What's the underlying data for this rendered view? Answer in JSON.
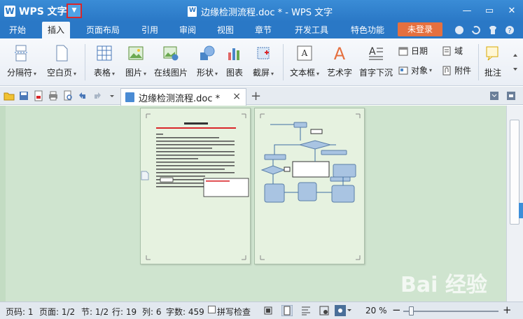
{
  "app": {
    "name": "WPS 文字",
    "menu_caret": "▼"
  },
  "window": {
    "title": "边缘检测流程.doc * - WPS 文字",
    "min": "—",
    "restore": "▭",
    "close": "✕"
  },
  "menu_tabs": [
    "开始",
    "插入",
    "页面布局",
    "引用",
    "审阅",
    "视图",
    "章节",
    "开发工具",
    "特色功能"
  ],
  "login": "未登录",
  "ribbon": {
    "separator": "分隔符",
    "blank_page": "空白页",
    "table": "表格",
    "picture": "图片",
    "online_picture": "在线图片",
    "shape": "形状",
    "chart": "图表",
    "screenshot": "截屏",
    "textbox": "文本框",
    "wordart": "艺术字",
    "dropcap": "首字下沉",
    "date": "日期",
    "field": "域",
    "object": "对象",
    "attachment": "附件",
    "annotate": "批注"
  },
  "doc_tab": {
    "label": "边缘检测流程.doc *",
    "close": "×",
    "add": "+"
  },
  "status": {
    "page_no": "页码: 1",
    "pages": "页面: 1/2",
    "section": "节: 1/2",
    "row": "行: 19",
    "col": "列: 6",
    "words": "字数: 459",
    "spellcheck": "拼写检查",
    "zoom": "20 %",
    "zoom_minus": "−",
    "zoom_plus": "+"
  },
  "watermark": "Bai 经验",
  "colors": {
    "accent": "#2a78c6",
    "login": "#e5703f",
    "workspace": "#cfe4cf"
  }
}
